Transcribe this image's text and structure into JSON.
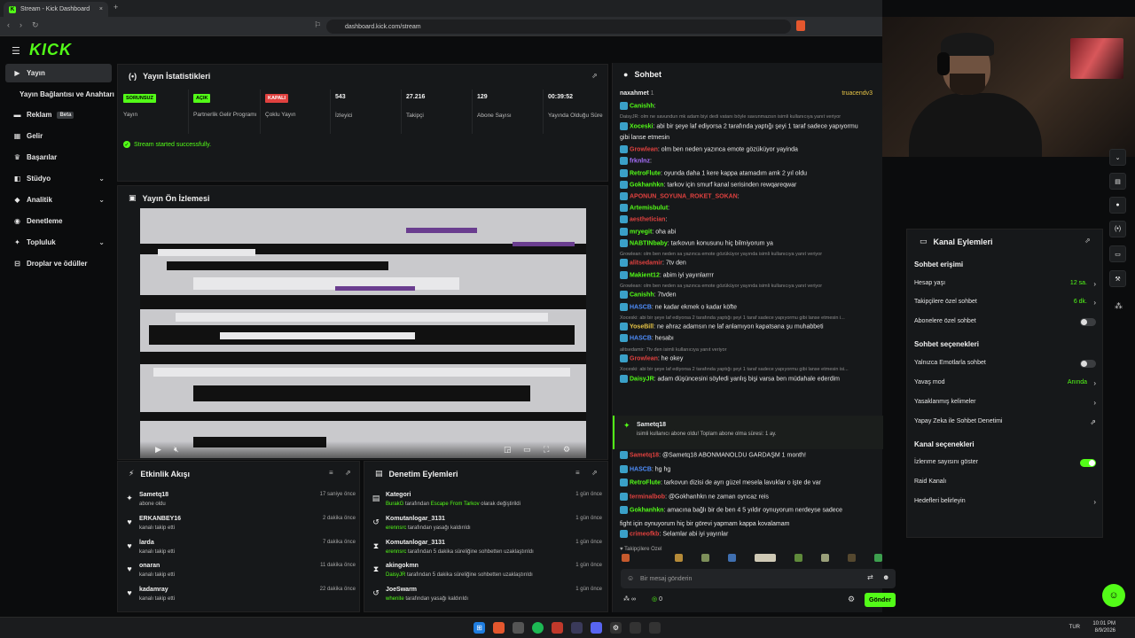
{
  "browser": {
    "tab_title": "Stream - Kick Dashboard",
    "tab_close": "×",
    "new_tab": "+",
    "url": "dashboard.kick.com/stream"
  },
  "header": {
    "logo": "KICK",
    "menu_icon": "☰"
  },
  "sidebar": {
    "items": [
      {
        "label": "Yayın",
        "icon": "▶"
      },
      {
        "label": "Yayın Bağlantısı ve Anahtarı",
        "icon": ""
      },
      {
        "label": "Reklam",
        "icon": "▬",
        "badge": "Beta"
      },
      {
        "label": "Gelir",
        "icon": "▦"
      },
      {
        "label": "Başarılar",
        "icon": "♛"
      },
      {
        "label": "Stüdyo",
        "icon": "◧",
        "chevron": "⌄"
      },
      {
        "label": "Analitik",
        "icon": "◆",
        "chevron": "⌄"
      },
      {
        "label": "Denetleme",
        "icon": "◉"
      },
      {
        "label": "Topluluk",
        "icon": "✦",
        "chevron": "⌄"
      },
      {
        "label": "Droplar ve ödüller",
        "icon": "⊟"
      }
    ]
  },
  "stats": {
    "title": "Yayın İstatistikleri",
    "items": [
      {
        "badge": "SORUNSUZ",
        "label": "Yayın"
      },
      {
        "badge": "AÇIK",
        "label": "Partnerlik Gelir Programı"
      },
      {
        "badge": "KAPALI",
        "label": "Çoklu Yayın"
      },
      {
        "value": "543",
        "label": "İzleyici"
      },
      {
        "value": "27.216",
        "label": "Takipçi"
      },
      {
        "value": "129",
        "label": "Abone Sayısı"
      },
      {
        "value": "00:39:52",
        "label": "Yayında Olduğu Süre"
      }
    ],
    "success_msg": "Stream started successfully."
  },
  "preview": {
    "title": "Yayın Ön İzlemesi"
  },
  "events": {
    "title": "Etkinlik Akışı",
    "rows": [
      {
        "icon": "✦",
        "name": "Sametq18",
        "sub": "abone oldu",
        "time": "17 saniye önce"
      },
      {
        "icon": "♥",
        "name": "ERKANBEY16",
        "sub": "kanalı takip etti",
        "time": "2 dakika önce"
      },
      {
        "icon": "♥",
        "name": "larda",
        "sub": "kanalı takip etti",
        "time": "7 dakika önce"
      },
      {
        "icon": "♥",
        "name": "onaran",
        "sub": "kanalı takip etti",
        "time": "11 dakika önce"
      },
      {
        "icon": "♥",
        "name": "kadamray",
        "sub": "kanalı takip etti",
        "time": "22 dakika önce"
      }
    ]
  },
  "mod_actions": {
    "title": "Denetim Eylemleri",
    "rows": [
      {
        "icon": "▤",
        "name": "Kategori",
        "actor": "BurakG",
        "text": " tarafından ",
        "extra": "Escape From Tarkov",
        "tail": " olarak değiştirildi",
        "time": "1 gün önce"
      },
      {
        "icon": "↺",
        "name": "Komutanlogar_3131",
        "actor": "erennsrc",
        "text": " tarafından yasağı kaldırıldı",
        "extra": "",
        "tail": "",
        "time": "1 gün önce"
      },
      {
        "icon": "⧗",
        "name": "Komutanlogar_3131",
        "actor": "erennsrc",
        "text": " tarafından 5 dakika süreliğine sohbetten uzaklaştırıldı",
        "extra": "",
        "tail": "",
        "time": "1 gün önce"
      },
      {
        "icon": "⧗",
        "name": "akingokmn",
        "actor": "DaisyJR",
        "text": " tarafından 5 dakika süreliğine sohbetten uzaklaştırıldı",
        "extra": "",
        "tail": "",
        "time": "1 gün önce"
      },
      {
        "icon": "↺",
        "name": "JoeSwarm",
        "actor": "whenite",
        "text": " tarafından yasağı kaldırıldı",
        "extra": "",
        "tail": "",
        "time": "1 gün önce"
      }
    ]
  },
  "chat": {
    "title": "Sohbet",
    "pinned_user": "naxahmet",
    "pinned_count": "1",
    "top_gifter": "truacendv3",
    "lines": [
      {
        "type": "msg",
        "user": "Canishh",
        "color": "#53fc18",
        "text": ""
      },
      {
        "type": "sys",
        "text": "DaisyJR: olm ne savundun mk adam biyi dedi vatanı böyle savunmazsın isimli kullanıcıya yanıt veriyor"
      },
      {
        "type": "msg",
        "user": "Xoceski",
        "color": "#53fc18",
        "text": "abi bir şeye laf ediyorsa 2 tarafında yaptığı şeyi 1 taraf sadece yapıyormu"
      },
      {
        "type": "cont",
        "text": "gibi lanse etmesin"
      },
      {
        "type": "msg",
        "user": "Growlean",
        "color": "#e0413f",
        "text": "olm ben neden  yazınca emote gözüküyor yayinda"
      },
      {
        "type": "msg",
        "user": "frknlnz",
        "color": "#a970ff",
        "text": ""
      },
      {
        "type": "msg",
        "user": "RetroFlute",
        "color": "#53fc18",
        "text": "oyunda daha 1 kere kappa atamadım amk 2 yıl oldu"
      },
      {
        "type": "msg",
        "user": "Gokhanhkn",
        "color": "#53fc18",
        "text": "tarkov için smurf kanal serisinden rewqareqwar"
      },
      {
        "type": "msg",
        "user": "APONUN_SOYUNA_ROKET_SOKAN",
        "color": "#e0413f",
        "text": ""
      },
      {
        "type": "msg",
        "user": "Artemisbulut",
        "color": "#53fc18",
        "text": ""
      },
      {
        "type": "msg",
        "user": "aesthetician",
        "color": "#e0413f",
        "text": ""
      },
      {
        "type": "msg",
        "user": "mryegit",
        "color": "#53fc18",
        "text": "oha abi"
      },
      {
        "type": "msg",
        "user": "NABTINbaby",
        "color": "#53fc18",
        "text": "tarkovun konusunu hiç bilmiyorum ya"
      },
      {
        "type": "sys",
        "text": "Growlean: olm ben neden sa yazınca emote gözüküyor yayında isimli kullanıcıya yanıt veriyor"
      },
      {
        "type": "msg",
        "user": "alitsedamir",
        "color": "#e0413f",
        "text": "7tv den"
      },
      {
        "type": "msg",
        "user": "Makient12",
        "color": "#53fc18",
        "text": " abim iyi yayınlarrrr"
      },
      {
        "type": "sys",
        "text": "Growlean: olm ben neden sa yazınca emote gözüküyor yayında isimli kullanıcıya yanıt veriyor"
      },
      {
        "type": "msg",
        "user": "Canishh",
        "color": "#53fc18",
        "text": "7tvden"
      },
      {
        "type": "msg",
        "user": "HASCB",
        "color": "#4f8fff",
        "text": "ne kadar ekmek o kadar köfte"
      },
      {
        "type": "sys",
        "text": "Xoceski: abi bir şeye laf ediyorsa 2 tarafında yaptığı şeyi 1 taraf sadece yapıyormu gibi lanse etmesin i..."
      },
      {
        "type": "msg",
        "user": "YoseBill",
        "color": "#e8c547",
        "text": "ne ahraz adamsın ne laf anlamıyon kapatsana şu muhabbeti"
      },
      {
        "type": "msg",
        "user": "HASCB",
        "color": "#4f8fff",
        "text": "hesabı"
      },
      {
        "type": "sys",
        "text": "alitsedamir: 7tv den isimli kullanıcıya yanıt veriyor"
      },
      {
        "type": "msg",
        "user": "Growlean",
        "color": "#e0413f",
        "text": "he okey"
      },
      {
        "type": "sys",
        "text": "Xoceski: abi bir şeye laf ediyorsa 2 tarafında yaptığı şeyi 1 taraf sadece yapıyormu gibi lanse etmesin isi..."
      },
      {
        "type": "msg",
        "user": "DaisyJR",
        "color": "#53fc18",
        "text": "adam düşüncesini söyledi yanlış bişi varsa ben müdahale ederdim"
      }
    ],
    "sub_event": {
      "user": "Sametq18",
      "text": "isimli kullanıcı abone oldu! Toplam abone olma süresi: 1 ay."
    },
    "lines2": [
      {
        "user": "Sametq18",
        "color": "#e0413f",
        "text": "@Sametq18 ABONMANOLDU GARDAŞM 1 month!"
      },
      {
        "user": "HASCB",
        "color": "#4f8fff",
        "text": "hg hg"
      },
      {
        "user": "RetroFlute",
        "color": "#53fc18",
        "text": "tarkovun dizisi de ayrı güzel mesela lavuklar o işte de var"
      },
      {
        "user": "terminalbob",
        "color": "#e0413f",
        "text": "@Gokhanhkn ne zaman oyncaz reis"
      },
      {
        "user": "Gokhanhkn",
        "color": "#53fc18",
        "text": "amacına bağlı bir de ben 4 5 yıldır oynuyorum nerdeyse sadece"
      },
      {
        "user": "",
        "color": "#e9e9e9",
        "text": "fight için oynuyorum hiç bir görevi yapmam kappa kovalamam"
      },
      {
        "user": "crimeofkb",
        "color": "#e0413f",
        "text": "Selamlar abi iyi yayınlar"
      }
    ],
    "followers_label": "Takipçilere Özel",
    "input_placeholder": "Bir mesaj gönderin",
    "send_label": "Gönder",
    "viewer_indicator": "∞",
    "points": "0"
  },
  "channel_actions": {
    "title": "Kanal Eylemleri",
    "sections": {
      "access": "Sohbet erişimi",
      "options": "Sohbet seçenekleri",
      "channel": "Kanal seçenekleri"
    },
    "rows": {
      "account_age": {
        "label": "Hesap yaşı",
        "value": "12 sa."
      },
      "followers_only": {
        "label": "Takipçilere özel sohbet",
        "value": "6 dk."
      },
      "subs_only": {
        "label": "Abonelere özel sohbet"
      },
      "emote_only": {
        "label": "Yalnızca Emotlarla sohbet"
      },
      "slow_mode": {
        "label": "Yavaş mod",
        "value": "Anında"
      },
      "banned_words": {
        "label": "Yasaklanmış kelimeler"
      },
      "ai_mod": {
        "label": "Yapay Zeka ile Sohbet Denetimi"
      },
      "show_viewers": {
        "label": "İzlenme sayısını göster"
      },
      "raid": {
        "label": "Raid Kanalı"
      },
      "targets": {
        "label": "Hedefleri belirleyin"
      }
    }
  },
  "taskbar": {
    "lang": "TUR",
    "time": "10:01 PM",
    "date": "8/9/2026"
  },
  "colors": {
    "accent": "#53fc18",
    "panel": "#16181a",
    "bg": "#0b0c0d"
  }
}
